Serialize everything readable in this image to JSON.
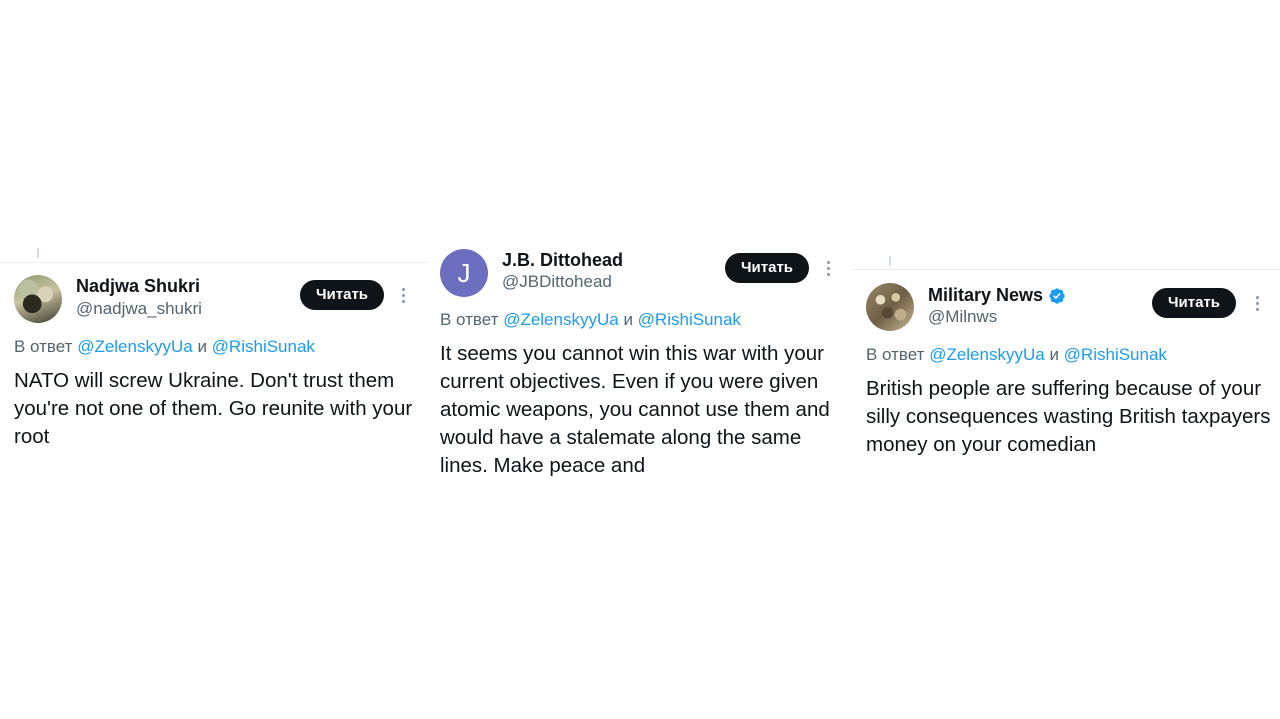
{
  "replying_label": "В ответ",
  "and_label": "и",
  "mentions": [
    "@ZelenskyyUa",
    "@RishiSunak"
  ],
  "follow_label": "Читать",
  "colors": {
    "link": "#1d9bf0",
    "muted": "#536471",
    "text": "#0f1419",
    "button": "#0f1419",
    "verified": "#1d9bf0"
  },
  "tweets": [
    {
      "name": "Nadjwa Shukri",
      "handle": "@nadjwa_shukri",
      "verified": false,
      "avatar": "photo",
      "text": "NATO will screw Ukraine. Don't trust them you're not one of them. Go reunite with your root"
    },
    {
      "name": "J.B. Dittohead",
      "handle": "@JBDittohead",
      "verified": false,
      "avatar_letter": "J",
      "text": "It seems you cannot win this war with your current objectives.  Even if you were given atomic weapons, you cannot use them and would have a stalemate along the same lines. Make peace and"
    },
    {
      "name": "Military News",
      "handle": "@Milnws",
      "verified": true,
      "avatar": "photo",
      "text": "British people are suffering because of your silly consequences wasting British taxpayers money on your comedian"
    }
  ]
}
